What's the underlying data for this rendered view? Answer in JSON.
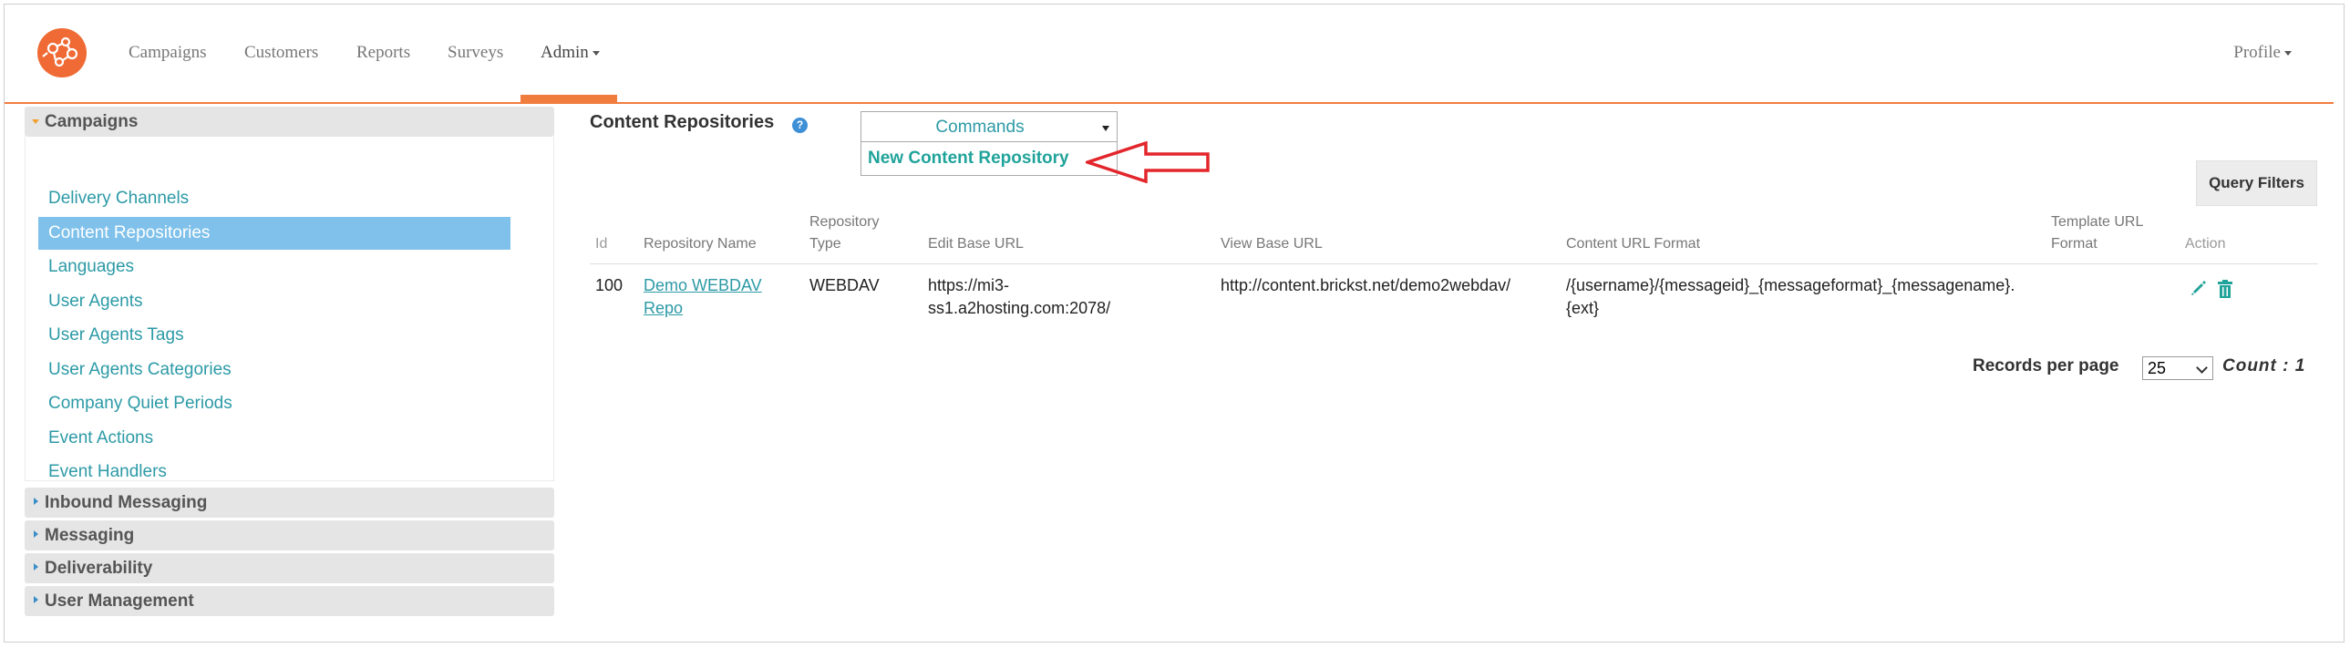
{
  "nav": {
    "items": [
      "Campaigns",
      "Customers",
      "Reports",
      "Surveys",
      "Admin"
    ],
    "profile": "Profile"
  },
  "sidebar": {
    "campaigns": {
      "title": "Campaigns",
      "links": [
        "Delivery Channels",
        "Content Repositories",
        "Languages",
        "User Agents",
        "User Agents Tags",
        "User Agents Categories",
        "Company Quiet Periods",
        "Event Actions",
        "Event Handlers"
      ],
      "selected": "Content Repositories"
    },
    "sections": [
      "Inbound Messaging",
      "Messaging",
      "Deliverability",
      "User Management"
    ]
  },
  "main": {
    "title": "Content Repositories",
    "help_glyph": "?",
    "commands_label": "Commands",
    "commands_menu_item": "New Content Repository",
    "query_filters": "Query Filters",
    "table": {
      "headers": {
        "id": "Id",
        "name": "Repository Name",
        "type_l1": "Repository",
        "type_l2": "Type",
        "edit_url": "Edit Base URL",
        "view_url": "View Base URL",
        "content_format": "Content URL Format",
        "template_l1": "Template URL",
        "template_l2": "Format",
        "action": "Action"
      },
      "rows": [
        {
          "id": "100",
          "name_l1": "Demo WEBDAV",
          "name_l2": "Repo",
          "type": "WEBDAV",
          "edit_l1": "https://mi3-",
          "edit_l2": "ss1.a2hosting.com:2078/",
          "view_url": "http://content.brickst.net/demo2webdav/",
          "format_l1": "/{username}/{messageid}_{messageformat}_{messagename}.",
          "format_l2": "{ext}",
          "template": ""
        }
      ]
    },
    "records_per_page_label": "Records per page",
    "records_per_page_value": "25",
    "count_label": "Count",
    "count_sep": ":",
    "count_value": "1"
  },
  "colors": {
    "accent_orange": "#f07c3e",
    "link_teal": "#2c9aa6",
    "selected_blue": "#7fc1ea",
    "arrow_red": "#e3262b"
  }
}
